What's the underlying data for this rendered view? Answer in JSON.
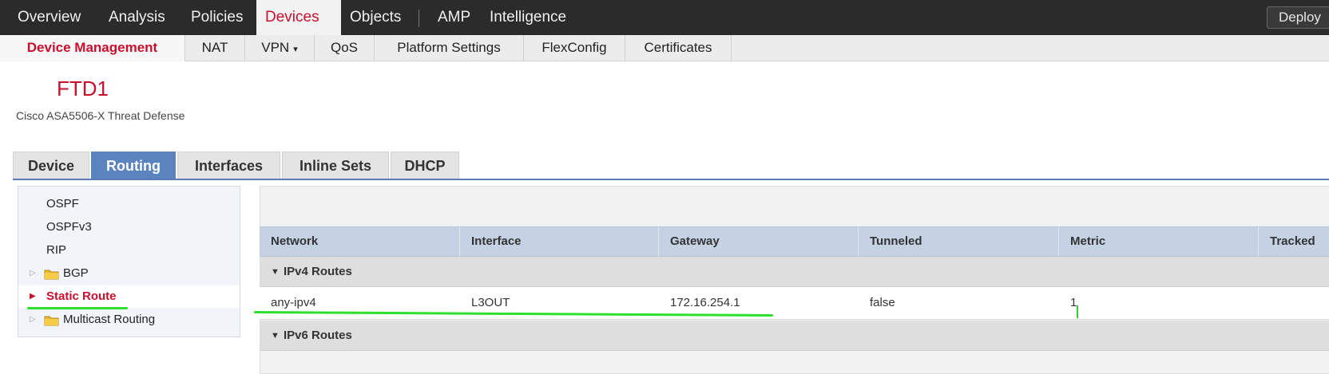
{
  "topnav": {
    "items": [
      "Overview",
      "Analysis",
      "Policies",
      "Devices",
      "Objects",
      "AMP",
      "Intelligence"
    ],
    "active": "Devices",
    "deploy_label": "Deploy"
  },
  "subnav": {
    "items": [
      "Device Management",
      "NAT",
      "VPN",
      "QoS",
      "Platform Settings",
      "FlexConfig",
      "Certificates"
    ],
    "active": "Device Management",
    "vpn_caret": "▾"
  },
  "device": {
    "name": "FTD1",
    "model": "Cisco ASA5506-X Threat Defense"
  },
  "tabs": {
    "items": [
      "Device",
      "Routing",
      "Interfaces",
      "Inline Sets",
      "DHCP"
    ],
    "active": "Routing"
  },
  "tree": {
    "items": [
      {
        "label": "OSPF",
        "folder": false,
        "expander": false
      },
      {
        "label": "OSPFv3",
        "folder": false,
        "expander": false
      },
      {
        "label": "RIP",
        "folder": false,
        "expander": false
      },
      {
        "label": "BGP",
        "folder": true,
        "expander": true
      },
      {
        "label": "Static Route",
        "folder": false,
        "expander": true,
        "selected": true
      },
      {
        "label": "Multicast Routing",
        "folder": true,
        "expander": true
      }
    ]
  },
  "table": {
    "columns": [
      "Network",
      "Interface",
      "Gateway",
      "Tunneled",
      "Metric",
      "Tracked"
    ],
    "groups": [
      "IPv4 Routes",
      "IPv6 Routes"
    ],
    "rows": [
      {
        "network": "any-ipv4",
        "interface": "L3OUT",
        "gateway": "172.16.254.1",
        "tunneled": "false",
        "metric": "1"
      }
    ]
  },
  "colors": {
    "accent_red": "#c8102e",
    "tab_blue": "#5b84bf",
    "table_header": "#c5d2e4",
    "annotation_green": "#2ee02e"
  }
}
